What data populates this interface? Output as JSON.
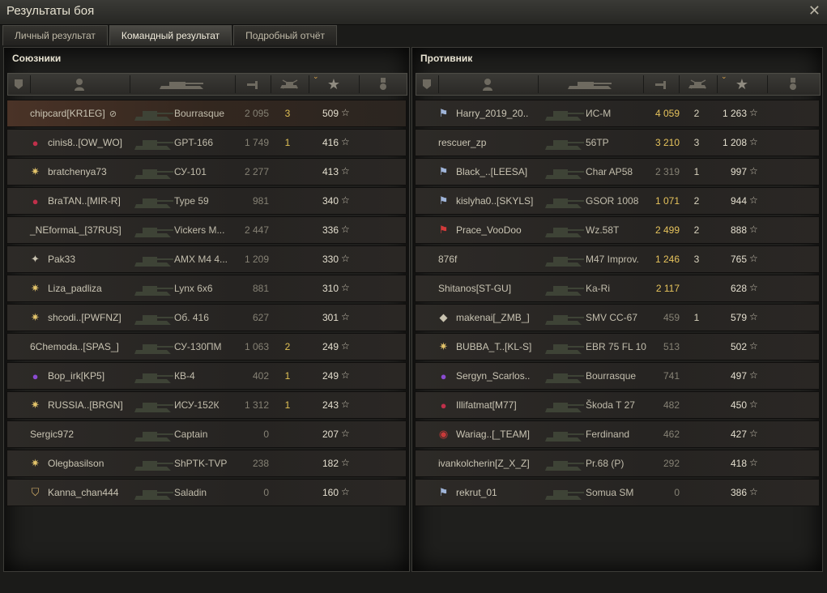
{
  "window": {
    "title": "Результаты боя",
    "close_icon": "close-icon"
  },
  "tabs": [
    {
      "label": "Личный результат",
      "active": false
    },
    {
      "label": "Командный результат",
      "active": true
    },
    {
      "label": "Подробный отчёт",
      "active": false
    }
  ],
  "columns": {
    "icons": [
      "platoon-icon",
      "player-icon",
      "tank-icon",
      "damage-icon",
      "kills-icon",
      "xp-star-icon",
      "medal-icon"
    ]
  },
  "allies": {
    "title": "Союзники",
    "rows": [
      {
        "player": "chipcard[KR1EG]",
        "badge": "",
        "tank": "Bourrasque",
        "damage": "2 095",
        "kills": "3",
        "xp": "509",
        "highlight": true,
        "hidden_icon": true
      },
      {
        "player": "cinis8..[OW_WO]",
        "badge": "red-clan-emblem",
        "tank": "GPT-166",
        "damage": "1 749",
        "kills": "1",
        "xp": "416"
      },
      {
        "player": "bratchenya73",
        "badge": "gold-star-emblem",
        "tank": "СУ-101",
        "damage": "2 277",
        "kills": "",
        "xp": "413"
      },
      {
        "player": "BraTAN..[MIR-R]",
        "badge": "red-clan-emblem",
        "tank": "Type 59",
        "damage": "981",
        "kills": "",
        "xp": "340"
      },
      {
        "player": "_NEformaL_[37RUS]",
        "badge": "",
        "tank": "Vickers M...",
        "damage": "2 447",
        "kills": "",
        "xp": "336"
      },
      {
        "player": "Pak33",
        "badge": "compass-emblem",
        "tank": "AMX M4 4...",
        "damage": "1 209",
        "kills": "",
        "xp": "330"
      },
      {
        "player": "Liza_padliza",
        "badge": "gold-star-emblem",
        "tank": "Lynx 6x6",
        "damage": "881",
        "kills": "",
        "xp": "310"
      },
      {
        "player": "shcodi..[PWFNZ]",
        "badge": "gold-star-emblem",
        "tank": "Об. 416",
        "damage": "627",
        "kills": "",
        "xp": "301"
      },
      {
        "player": "6Chemoda..[SPAS_]",
        "badge": "",
        "tank": "СУ-130ПМ",
        "damage": "1 063",
        "kills": "2",
        "xp": "249"
      },
      {
        "player": "Bop_irk[KP5]",
        "badge": "purple-emblem",
        "tank": "КВ-4",
        "damage": "402",
        "kills": "1",
        "xp": "249"
      },
      {
        "player": "RUSSIA..[BRGN]",
        "badge": "gold-star-emblem",
        "tank": "ИСУ-152К",
        "damage": "1 312",
        "kills": "1",
        "xp": "243"
      },
      {
        "player": "Sergic972",
        "badge": "",
        "tank": "Captain",
        "damage": "0",
        "kills": "",
        "xp": "207"
      },
      {
        "player": "Olegbasilson",
        "badge": "gold-star-emblem",
        "tank": "ShPTK-TVP",
        "damage": "238",
        "kills": "",
        "xp": "182"
      },
      {
        "player": "Kanna_chan444",
        "badge": "shield-emblem",
        "tank": "Saladin",
        "damage": "0",
        "kills": "",
        "xp": "160"
      }
    ]
  },
  "enemies": {
    "title": "Противник",
    "rows": [
      {
        "player": "Harry_2019_20..",
        "badge": "flag-emblem",
        "tank": "ИС-М",
        "damage": "4 059",
        "damage_hi": true,
        "kills": "2",
        "xp": "1 263"
      },
      {
        "player": "rescuer_zp",
        "badge": "",
        "tank": "56TP",
        "damage": "3 210",
        "damage_hi": true,
        "kills": "3",
        "xp": "1 208"
      },
      {
        "player": "Black_..[LEESA]",
        "badge": "flag-emblem",
        "tank": "Char AP58",
        "damage": "2 319",
        "kills": "1",
        "xp": "997"
      },
      {
        "player": "kislyha0..[SKYLS]",
        "badge": "flag-emblem",
        "tank": "GSOR 1008",
        "damage": "1 071",
        "damage_hi": true,
        "kills": "2",
        "xp": "944"
      },
      {
        "player": "Prace_VooDoo",
        "badge": "red-flag-emblem",
        "tank": "Wz.58T",
        "damage": "2 499",
        "damage_hi": true,
        "kills": "2",
        "xp": "888"
      },
      {
        "player": "876f",
        "badge": "",
        "tank": "M47 Improv.",
        "damage": "1 246",
        "damage_hi": true,
        "kills": "3",
        "xp": "765"
      },
      {
        "player": "Shitanos[ST-GU]",
        "badge": "",
        "tank": "Ka-Ri",
        "damage": "2 117",
        "damage_hi": true,
        "kills": "",
        "xp": "628"
      },
      {
        "player": "makenai[_ZMB_]",
        "badge": "diamond-emblem",
        "tank": "SMV CC-67",
        "damage": "459",
        "kills": "1",
        "xp": "579"
      },
      {
        "player": "BUBBA_T..[KL-S]",
        "badge": "gold-star-emblem",
        "tank": "EBR 75 FL 10",
        "damage": "513",
        "kills": "",
        "xp": "502"
      },
      {
        "player": "Sergyn_Scarlos..",
        "badge": "purple-emblem",
        "tank": "Bourrasque",
        "damage": "741",
        "kills": "",
        "xp": "497"
      },
      {
        "player": "Illifatmat[M77]",
        "badge": "red-clan-emblem",
        "tank": "Škoda T 27",
        "damage": "482",
        "kills": "",
        "xp": "450"
      },
      {
        "player": "Wariag..[_TEAM]",
        "badge": "red-eye-emblem",
        "tank": "Ferdinand",
        "damage": "462",
        "kills": "",
        "xp": "427"
      },
      {
        "player": "ivankolcherin[Z_X_Z]",
        "badge": "",
        "tank": "Pr.68 (P)",
        "damage": "292",
        "kills": "",
        "xp": "418"
      },
      {
        "player": "rekrut_01",
        "badge": "flag-emblem",
        "tank": "Somua SM",
        "damage": "0",
        "kills": "",
        "xp": "386"
      }
    ]
  },
  "colors": {
    "damage_highlight": "#e6c35c",
    "ally_kills": "#e0c055",
    "sort_arrow": "#d9a24a"
  }
}
